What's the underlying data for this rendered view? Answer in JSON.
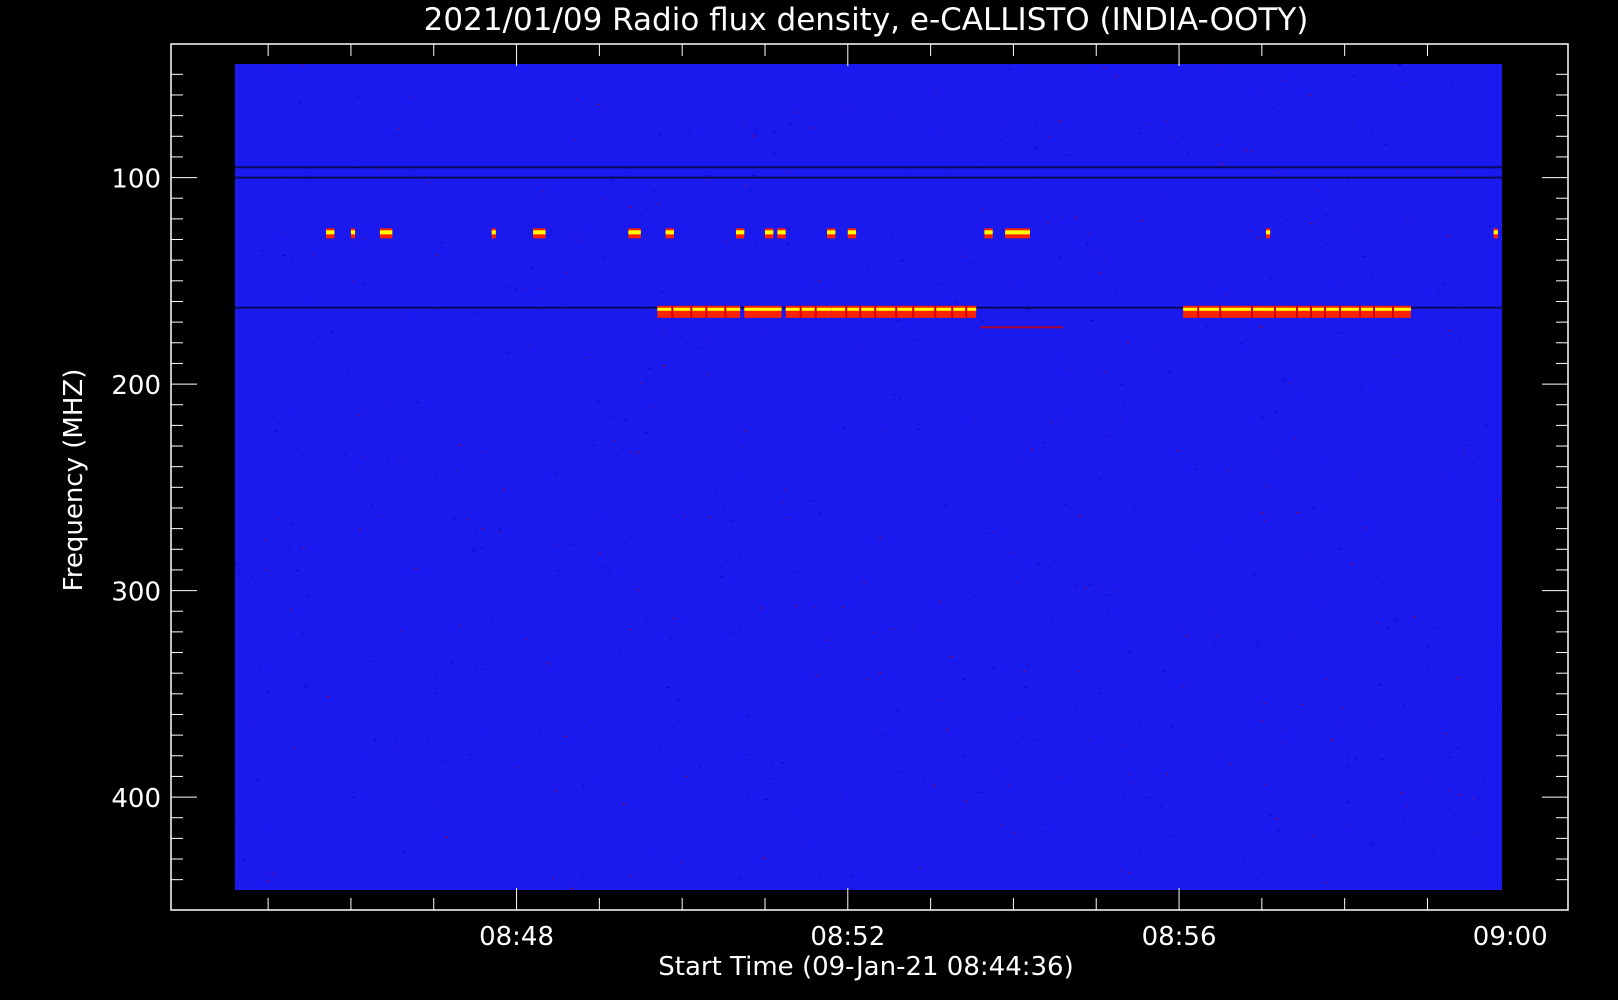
{
  "chart_data": {
    "type": "heatmap",
    "title": "2021/01/09  Radio flux density, e-CALLISTO (INDIA-OOTY)",
    "xlabel": "Start Time (09-Jan-21 08:44:36)",
    "ylabel": "Frequency (MHZ)",
    "x_ticks": [
      "08:48",
      "08:52",
      "08:56",
      "09:00"
    ],
    "y_ticks": [
      "100",
      "200",
      "300",
      "400"
    ],
    "time_range_min": [
      0,
      15.3
    ],
    "freq_range_mhz": [
      45,
      445
    ],
    "grid": false,
    "colors": {
      "background": "#000000",
      "field": "#1a1aee",
      "low": "#0000b4",
      "medium": "#cc0000",
      "high": "#ff2200",
      "peak": "#ffff00"
    },
    "bursts": [
      {
        "freq_mhz": 165,
        "start_min": 5.1,
        "end_min": 6.1
      },
      {
        "freq_mhz": 165,
        "start_min": 6.15,
        "end_min": 6.6
      },
      {
        "freq_mhz": 165,
        "start_min": 6.65,
        "end_min": 7.2
      },
      {
        "freq_mhz": 165,
        "start_min": 7.2,
        "end_min": 8.95
      },
      {
        "freq_mhz": 165,
        "start_min": 11.45,
        "end_min": 12.1
      },
      {
        "freq_mhz": 165,
        "start_min": 12.1,
        "end_min": 14.2
      },
      {
        "freq_mhz": 127,
        "start_min": 1.1,
        "end_min": 1.2
      },
      {
        "freq_mhz": 127,
        "start_min": 1.4,
        "end_min": 1.45
      },
      {
        "freq_mhz": 127,
        "start_min": 1.75,
        "end_min": 1.9
      },
      {
        "freq_mhz": 127,
        "start_min": 3.1,
        "end_min": 3.15
      },
      {
        "freq_mhz": 127,
        "start_min": 3.6,
        "end_min": 3.75
      },
      {
        "freq_mhz": 127,
        "start_min": 4.75,
        "end_min": 4.9
      },
      {
        "freq_mhz": 127,
        "start_min": 5.2,
        "end_min": 5.3
      },
      {
        "freq_mhz": 127,
        "start_min": 6.05,
        "end_min": 6.15
      },
      {
        "freq_mhz": 127,
        "start_min": 6.4,
        "end_min": 6.5
      },
      {
        "freq_mhz": 127,
        "start_min": 6.55,
        "end_min": 6.65
      },
      {
        "freq_mhz": 127,
        "start_min": 7.15,
        "end_min": 7.25
      },
      {
        "freq_mhz": 127,
        "start_min": 7.4,
        "end_min": 7.5
      },
      {
        "freq_mhz": 127,
        "start_min": 9.05,
        "end_min": 9.15
      },
      {
        "freq_mhz": 127,
        "start_min": 9.3,
        "end_min": 9.6
      },
      {
        "freq_mhz": 127,
        "start_min": 12.45,
        "end_min": 12.5
      },
      {
        "freq_mhz": 127,
        "start_min": 15.2,
        "end_min": 15.25
      }
    ],
    "dark_lines_mhz": [
      95,
      100,
      163
    ]
  }
}
